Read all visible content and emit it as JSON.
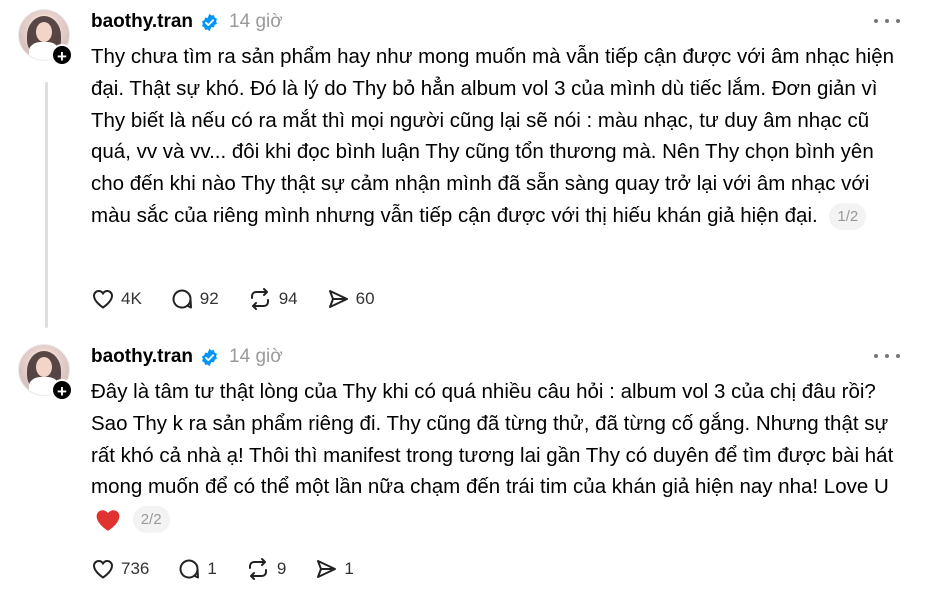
{
  "posts": [
    {
      "username": "baothy.tran",
      "timestamp": "14 giờ",
      "content": "Thy chưa tìm ra sản phẩm hay như mong muốn mà vẫn tiếp cận được với âm nhạc hiện đại. Thật sự khó. Đó là lý do Thy bỏ hẳn album vol 3 của mình dù tiếc lắm. Đơn giản vì Thy biết là nếu có ra mắt thì mọi người cũng lại sẽ nói : màu nhạc, tư duy âm nhạc cũ quá, vv và vv... đôi khi đọc bình luận Thy cũng tổn thương mà. Nên Thy chọn bình yên cho đến khi nào Thy thật sự cảm nhận mình đã sẵn sàng quay trở lại với âm nhạc với màu sắc của riêng mình nhưng vẫn tiếp cận được với thị hiếu khán giả hiện đại.",
      "pager": "1/2",
      "likes": "4K",
      "comments": "92",
      "reposts": "94",
      "shares": "60"
    },
    {
      "username": "baothy.tran",
      "timestamp": "14 giờ",
      "content": "Đây là tâm tư thật lòng của Thy khi có quá nhiều câu hỏi : album vol 3 của chị đâu rồi? Sao Thy k ra sản phẩm riêng đi. Thy cũng đã từng thử, đã từng cố gắng. Nhưng thật sự rất khó cả nhà ạ! Thôi thì manifest trong tương lai gần Thy có duyên để tìm được bài hát mong muốn để có thể một lần nữa chạm đến trái tim của khán giả hiện nay nha! Love U",
      "pager": "2/2",
      "likes": "736",
      "comments": "1",
      "reposts": "9",
      "shares": "1"
    }
  ],
  "icons": {
    "verified": "verified-badge-icon",
    "more": "more-options-icon",
    "like": "heart-outline-icon",
    "comment": "comment-bubble-icon",
    "repost": "repost-arrows-icon",
    "share": "send-arrow-icon",
    "emoji": "red-heart-emoji-icon"
  },
  "colors": {
    "verified": "#0095f6",
    "muted": "#9a9a9a",
    "heart_emoji": "#e0322f"
  }
}
